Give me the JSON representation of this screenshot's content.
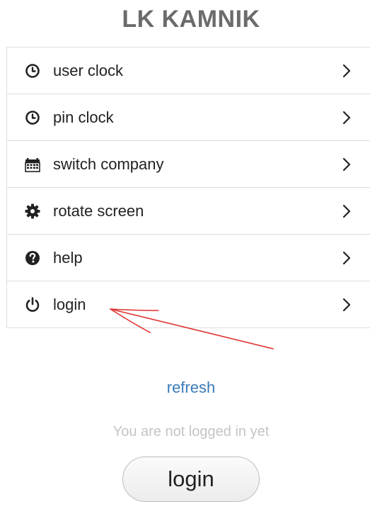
{
  "header": {
    "title": "LK KAMNIK"
  },
  "menu": {
    "items": [
      {
        "label": "user clock",
        "icon": "clock-icon"
      },
      {
        "label": "pin clock",
        "icon": "clock-icon"
      },
      {
        "label": "switch company",
        "icon": "calendar-icon"
      },
      {
        "label": "rotate screen",
        "icon": "gear-icon"
      },
      {
        "label": "help",
        "icon": "question-circle-icon"
      },
      {
        "label": "login",
        "icon": "power-icon"
      }
    ]
  },
  "footer": {
    "refresh_label": "refresh",
    "status_text": "You are not logged in yet",
    "login_button_label": "login"
  },
  "colors": {
    "title": "#6b6b6b",
    "link": "#3a7ab8",
    "status": "#c4c4c4",
    "annotation_arrow": "#e03030"
  }
}
